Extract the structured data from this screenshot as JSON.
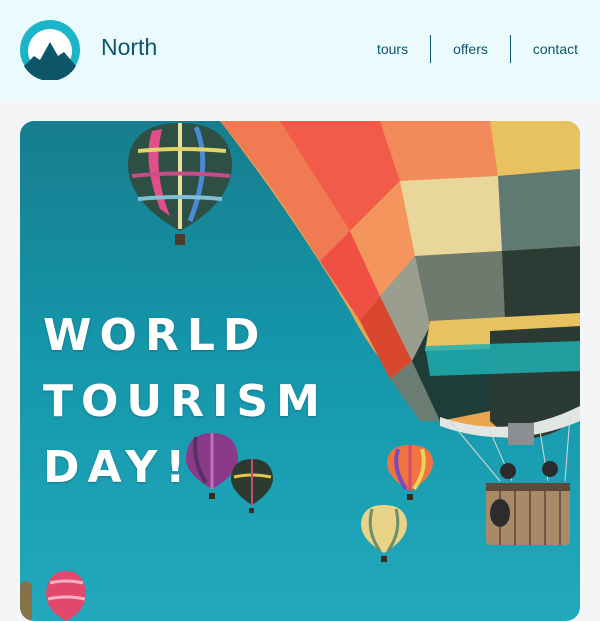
{
  "header": {
    "brand": "North",
    "logo_icon": "mountain-logo-icon",
    "nav": [
      {
        "label": "tours"
      },
      {
        "label": "offers"
      },
      {
        "label": "contact"
      }
    ]
  },
  "hero": {
    "headline_lines": [
      "WORLD",
      "TOURISM",
      "DAY!"
    ],
    "image": "hot-air-balloons-image"
  },
  "colors": {
    "header_bg": "#ebfbfd",
    "brand_text": "#0d5569",
    "logo_ring": "#1ab5c9",
    "sky": "#1596aa"
  }
}
